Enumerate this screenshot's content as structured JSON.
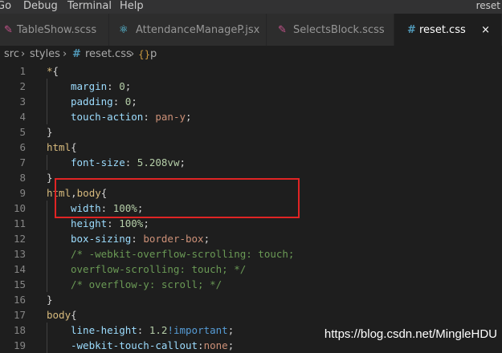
{
  "menubar": {
    "items": [
      "Go",
      "Debug",
      "Terminal",
      "Help"
    ],
    "window_title": "reset"
  },
  "tabs": [
    {
      "label": "TableShow.scss",
      "icon": "sass-icon",
      "active": false
    },
    {
      "label": "AttendanceManageP.jsx",
      "icon": "react-icon",
      "active": false
    },
    {
      "label": "SelectsBlock.scss",
      "icon": "sass-icon",
      "active": false
    },
    {
      "label": "reset.css",
      "icon": "css-hash-icon",
      "active": true,
      "close": "×"
    }
  ],
  "breadcrumb": {
    "items": [
      "src",
      "styles",
      "reset.css",
      "p"
    ],
    "separator": "›"
  },
  "code_lines": [
    {
      "n": "1",
      "tokens": [
        [
          "sel",
          "*"
        ],
        [
          "punc",
          "{"
        ]
      ]
    },
    {
      "n": "2",
      "tokens": [
        [
          "prop",
          "margin"
        ],
        [
          "punc",
          ": "
        ],
        [
          "num",
          "0"
        ],
        [
          "punc",
          ";"
        ]
      ]
    },
    {
      "n": "3",
      "tokens": [
        [
          "prop",
          "padding"
        ],
        [
          "punc",
          ": "
        ],
        [
          "num",
          "0"
        ],
        [
          "punc",
          ";"
        ]
      ]
    },
    {
      "n": "4",
      "tokens": [
        [
          "prop",
          "touch-action"
        ],
        [
          "punc",
          ": "
        ],
        [
          "val",
          "pan-y"
        ],
        [
          "punc",
          ";"
        ]
      ]
    },
    {
      "n": "5",
      "tokens": [
        [
          "punc",
          "}"
        ]
      ]
    },
    {
      "n": "6",
      "tokens": [
        [
          "sel",
          "html"
        ],
        [
          "punc",
          "{"
        ]
      ]
    },
    {
      "n": "7",
      "tokens": [
        [
          "prop",
          "font-size"
        ],
        [
          "punc",
          ": "
        ],
        [
          "num",
          "5.208vw"
        ],
        [
          "punc",
          ";"
        ]
      ]
    },
    {
      "n": "8",
      "tokens": [
        [
          "punc",
          "}"
        ]
      ]
    },
    {
      "n": "9",
      "tokens": [
        [
          "sel",
          "html"
        ],
        [
          "punc",
          ","
        ],
        [
          "sel",
          "body"
        ],
        [
          "punc",
          "{"
        ]
      ]
    },
    {
      "n": "10",
      "tokens": [
        [
          "prop",
          "width"
        ],
        [
          "punc",
          ": "
        ],
        [
          "num",
          "100%"
        ],
        [
          "punc",
          ";"
        ]
      ]
    },
    {
      "n": "11",
      "tokens": [
        [
          "prop",
          "height"
        ],
        [
          "punc",
          ": "
        ],
        [
          "num",
          "100%"
        ],
        [
          "punc",
          ";"
        ]
      ]
    },
    {
      "n": "12",
      "tokens": [
        [
          "prop",
          "box-sizing"
        ],
        [
          "punc",
          ": "
        ],
        [
          "val",
          "border-box"
        ],
        [
          "punc",
          ";"
        ]
      ]
    },
    {
      "n": "13",
      "tokens": [
        [
          "com",
          "/* -webkit-overflow-scrolling: touch;"
        ]
      ]
    },
    {
      "n": "14",
      "tokens": [
        [
          "com",
          "overflow-scrolling: touch; */"
        ]
      ]
    },
    {
      "n": "15",
      "tokens": [
        [
          "com",
          "/* overflow-y: scroll; */"
        ]
      ]
    },
    {
      "n": "16",
      "tokens": [
        [
          "punc",
          "}"
        ]
      ]
    },
    {
      "n": "17",
      "tokens": [
        [
          "sel",
          "body"
        ],
        [
          "punc",
          "{"
        ]
      ]
    },
    {
      "n": "18",
      "tokens": [
        [
          "prop",
          "line-height"
        ],
        [
          "punc",
          ": "
        ],
        [
          "num",
          "1.2"
        ],
        [
          "imp",
          "!important"
        ],
        [
          "punc",
          ";"
        ]
      ]
    },
    {
      "n": "19",
      "tokens": [
        [
          "prop",
          "-webkit-touch-callout"
        ],
        [
          "punc",
          ":"
        ],
        [
          "val",
          "none"
        ],
        [
          "punc",
          ";"
        ]
      ]
    }
  ],
  "watermark": "https://blog.csdn.net/MingleHDU",
  "colors": {
    "selector": "#d7ba7d",
    "property": "#9cdcfe",
    "number": "#b5cea8",
    "string_value": "#ce9178",
    "comment": "#6a9955",
    "highlight_box": "#e02424"
  }
}
